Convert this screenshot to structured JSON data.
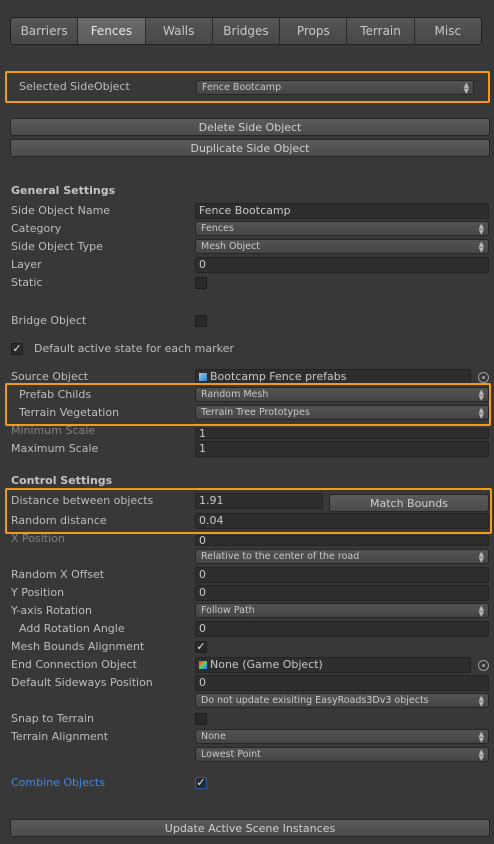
{
  "tabs": [
    "Barriers",
    "Fences",
    "Walls",
    "Bridges",
    "Props",
    "Terrain",
    "Misc"
  ],
  "active_tab": "Fences",
  "selected_side_object": {
    "label": "Selected SideObject",
    "value": "Fence Bootcamp"
  },
  "buttons": {
    "delete": "Delete Side Object",
    "duplicate": "Duplicate Side Object",
    "match_bounds": "Match Bounds",
    "update": "Update Active Scene Instances"
  },
  "general": {
    "title": "General Settings",
    "name_label": "Side Object Name",
    "name_value": "Fence Bootcamp",
    "category_label": "Category",
    "category_value": "Fences",
    "type_label": "Side Object Type",
    "type_value": "Mesh Object",
    "layer_label": "Layer",
    "layer_value": "0",
    "static_label": "Static",
    "static_checked": false,
    "bridge_label": "Bridge Object",
    "bridge_checked": false,
    "default_active_label": "Default active state for each marker",
    "default_active_checked": true,
    "source_label": "Source Object",
    "source_value": "Bootcamp Fence prefabs",
    "prefab_label": "Prefab Childs",
    "prefab_value": "Random Mesh",
    "vegetation_label": "Terrain Vegetation",
    "vegetation_value": "Terrain Tree Prototypes",
    "min_scale_label": "Minimum Scale",
    "min_scale_value": "1",
    "max_scale_label": "Maximum Scale",
    "max_scale_value": "1"
  },
  "control": {
    "title": "Control Settings",
    "distance_label": "Distance between objects",
    "distance_value": "1.91",
    "random_distance_label": "Random distance",
    "random_distance_value": "0.04",
    "x_pos_label": "X Position",
    "x_pos_value": "0",
    "x_pos_mode": "Relative to the center of the road",
    "random_x_label": "Random X Offset",
    "random_x_value": "0",
    "y_pos_label": "Y Position",
    "y_pos_value": "0",
    "y_rot_label": "Y-axis Rotation",
    "y_rot_value": "Follow Path",
    "add_rot_label": "Add Rotation Angle",
    "add_rot_value": "0",
    "mesh_bounds_label": "Mesh Bounds Alignment",
    "mesh_bounds_checked": true,
    "end_conn_label": "End Connection Object",
    "end_conn_value": "None (Game Object)",
    "sideways_label": "Default Sideways Position",
    "sideways_value": "0",
    "update_mode": "Do not update exisiting EasyRoads3Dv3 objects",
    "snap_label": "Snap to Terrain",
    "snap_checked": false,
    "terrain_align_label": "Terrain Alignment",
    "terrain_align_value": "None",
    "terrain_point_value": "Lowest Point",
    "combine_label": "Combine Objects",
    "combine_checked": true
  },
  "colors": {
    "highlight": "#f39c12",
    "link": "#4a86d8",
    "background": "#383838"
  },
  "icons": {
    "source_object": "prefab-cube-icon",
    "end_connection": "gameobject-cube-icon",
    "object_picker": "object-picker-icon"
  }
}
